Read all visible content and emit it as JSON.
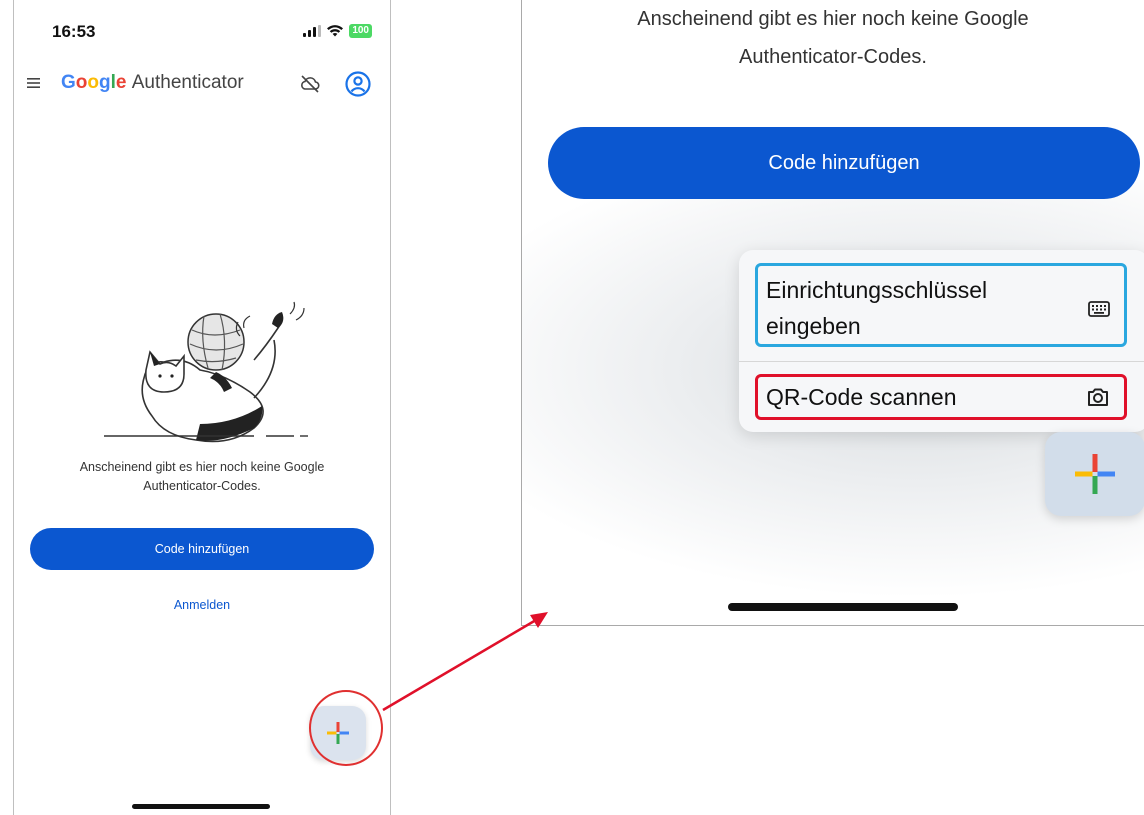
{
  "status_bar": {
    "time": "16:53",
    "battery": "100"
  },
  "header": {
    "brand_google": "Google",
    "brand_app": "Authenticator",
    "menu_icon": "hamburger-menu-icon",
    "cloud_icon": "cloud-off-icon",
    "account_icon": "account-circle-icon"
  },
  "empty_state": {
    "message_line1": "Anscheinend gibt es hier noch keine Google",
    "message_line2": "Authenticator-Codes.",
    "illustration": "cat-with-yarn-ball"
  },
  "actions": {
    "add_code_label": "Code hinzufügen",
    "signin_label": "Anmelden"
  },
  "fab": {
    "icon": "google-plus-icon"
  },
  "zoom_panel": {
    "cut_text": "Anscheinend gibt es hier noch keine Google",
    "message": "Authenticator-Codes.",
    "add_code_label": "Code hinzufügen",
    "menu": {
      "setup_key_line1": "Einrichtungsschlüssel",
      "setup_key_line2": "eingeben",
      "setup_key_icon": "keyboard-icon",
      "scan_qr_label": "QR-Code scannen",
      "scan_qr_icon": "camera-icon"
    }
  },
  "colors": {
    "primary": "#0b57d0",
    "highlight_red": "#e03030",
    "highlight_blue": "#2aa7df",
    "fab_bg": "#dbe3ee"
  }
}
